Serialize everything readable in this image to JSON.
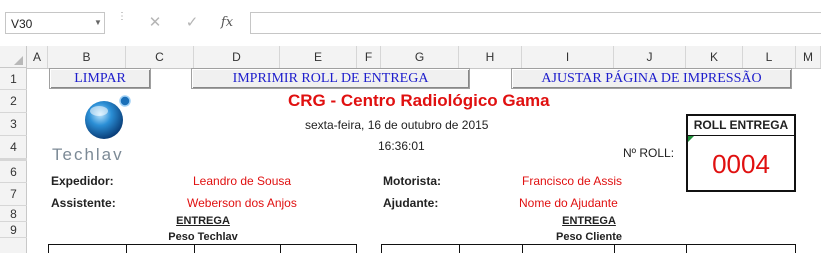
{
  "formula_bar": {
    "name_box": "V30",
    "cancel_glyph": "✕",
    "enter_glyph": "✓",
    "fx_label": "fx",
    "formula": ""
  },
  "columns": [
    "A",
    "B",
    "C",
    "D",
    "E",
    "F",
    "G",
    "H",
    "I",
    "J",
    "K",
    "L",
    "M"
  ],
  "rows": [
    "1",
    "2",
    "3",
    "4",
    "6",
    "7",
    "8",
    "9"
  ],
  "buttons": {
    "limpar": "LIMPAR",
    "imprimir": "IMPRIMIR ROLL DE ENTREGA",
    "ajustar": "AJUSTAR PÁGINA DE IMPRESSÃO"
  },
  "logo": {
    "text": "Techlav",
    "icon": "globe-logo-icon"
  },
  "header": {
    "title": "CRG - Centro Radiológico Gama",
    "date": "sexta-feira, 16 de outubro de 2015",
    "time": "16:36:01"
  },
  "roll": {
    "box_title": "ROLL ENTREGA",
    "label": "Nº ROLL:",
    "number": "0004"
  },
  "fields": {
    "expedidor_label": "Expedidor:",
    "expedidor_value": "Leandro de Sousa",
    "assistente_label": "Assistente:",
    "assistente_value": "Weberson dos Anjos",
    "motorista_label": "Motorista:",
    "motorista_value": "Francisco de Assis",
    "ajudante_label": "Ajudante:",
    "ajudante_value": "Nome do Ajudante"
  },
  "sections": {
    "left_title": "ENTREGA",
    "left_sub": "Peso Techlav",
    "right_title": "ENTREGA",
    "right_sub": "Peso Cliente"
  },
  "colors": {
    "accent_red": "#e01010",
    "button_text": "#1d1dcc"
  }
}
